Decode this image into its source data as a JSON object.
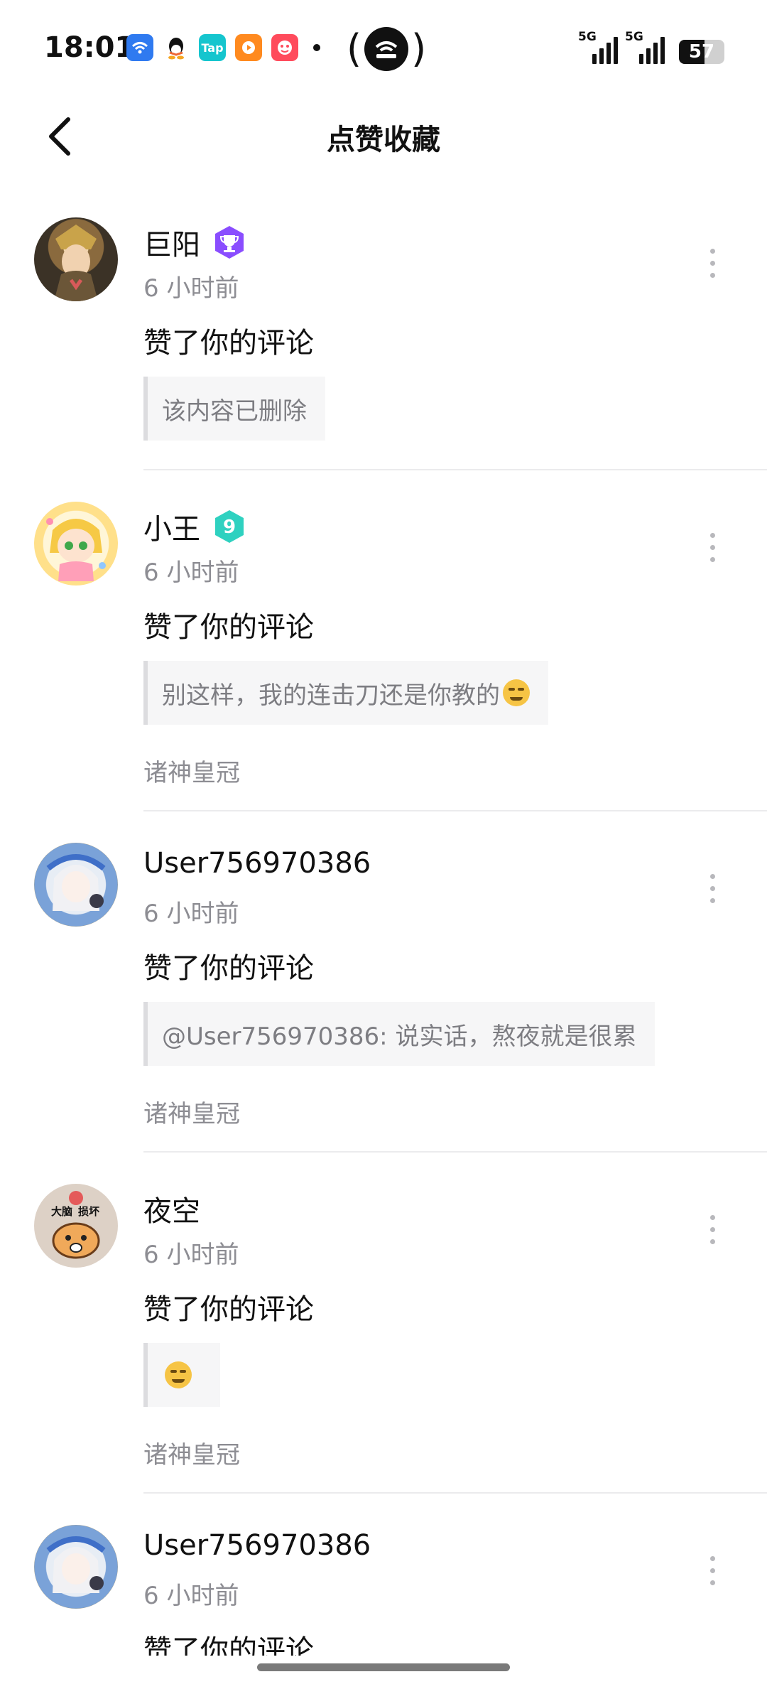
{
  "status_bar": {
    "time": "18:01",
    "battery": "57",
    "signal_labels": [
      "5G",
      "5G"
    ]
  },
  "nav": {
    "title": "点赞收藏"
  },
  "colors": {
    "accent_purple": "#8a4dff",
    "accent_teal": "#2fd1c0",
    "muted_text": "#8d8d93"
  },
  "notifications": [
    {
      "user": "巨阳",
      "badge": "trophy-badge",
      "time": "6 小时前",
      "action": "赞了你的评论",
      "quote": "该内容已删除",
      "source": ""
    },
    {
      "user": "小王",
      "badge": "level-9-badge",
      "badge_text": "9",
      "time": "6 小时前",
      "action": "赞了你的评论",
      "quote": "别这样，我的连击刀还是你教的",
      "source": "诸神皇冠"
    },
    {
      "user": "User756970386",
      "badge": "",
      "time": "6 小时前",
      "action": "赞了你的评论",
      "quote": "@User756970386: 说实话，熬夜就是很累",
      "source": "诸神皇冠"
    },
    {
      "user": "夜空",
      "badge": "",
      "avatar_text": [
        "大脑",
        "损坏"
      ],
      "time": "6 小时前",
      "action": "赞了你的评论",
      "quote": "",
      "source": "诸神皇冠"
    },
    {
      "user": "User756970386",
      "badge": "",
      "time": "6 小时前",
      "action": "赞了你的评论",
      "quote": "",
      "source": ""
    }
  ]
}
